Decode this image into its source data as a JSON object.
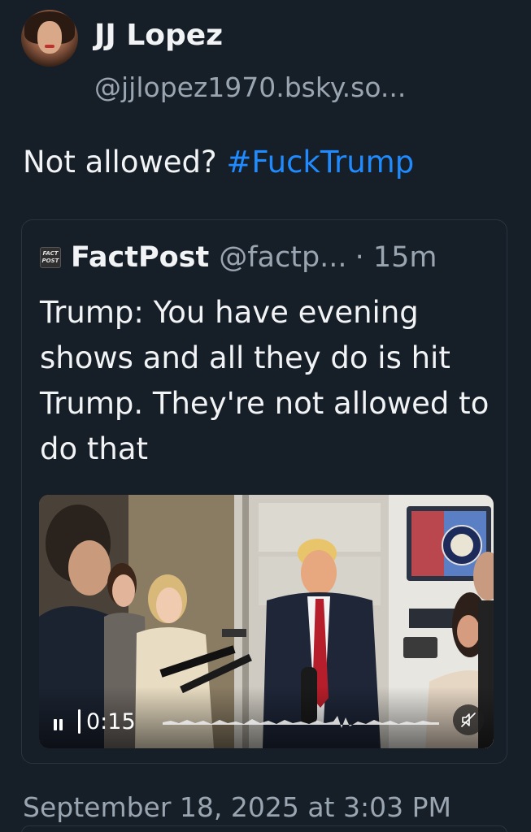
{
  "author": {
    "display_name": "JJ Lopez",
    "handle": "@jjlopez1970.bsky.so..."
  },
  "post": {
    "text_plain": "Not allowed? ",
    "hashtag": "#FuckTrump",
    "timestamp": "September 18, 2025 at 3:03 PM"
  },
  "quote": {
    "source_icon_text_line1": "FACT",
    "source_icon_text_line2": "POST",
    "display_name": "FactPost",
    "handle": "@factp...",
    "separator": "·",
    "age": "15m",
    "text": "Trump: You have evening shows and all they do is hit Trump. They're not allowed to do that",
    "video": {
      "elapsed": "0:15",
      "state": "playing",
      "muted": true
    }
  },
  "colors": {
    "background": "#161e27",
    "text": "#f1f3f5",
    "muted_text": "#9aa5b2",
    "link": "#208bfe",
    "border": "#2a3440"
  }
}
